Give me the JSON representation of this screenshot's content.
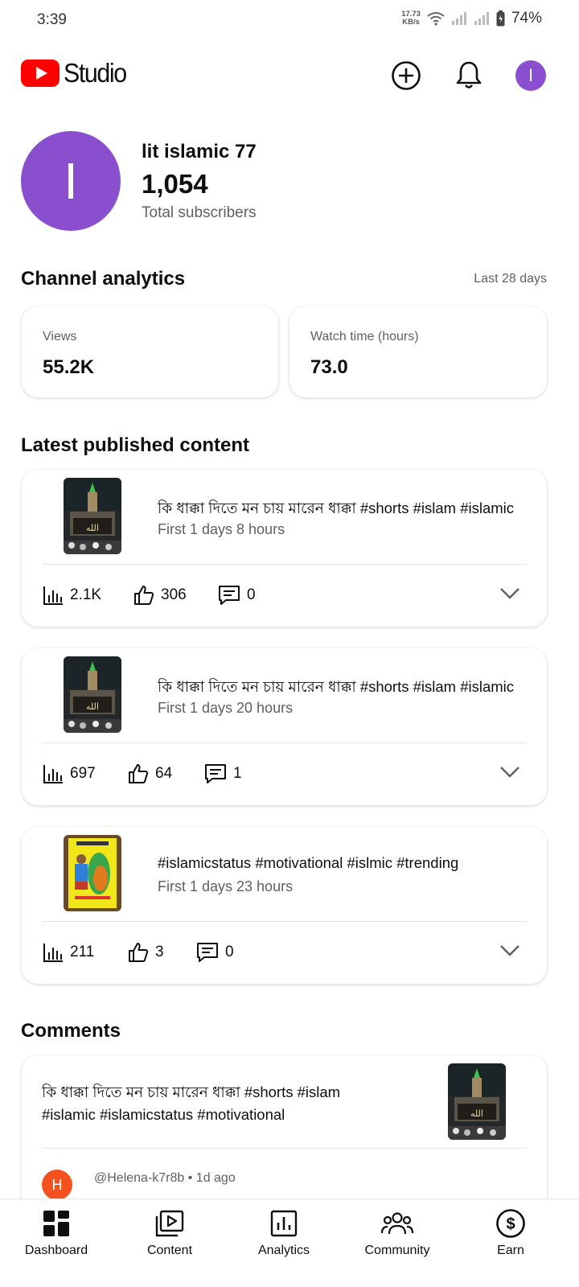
{
  "status_bar": {
    "time": "3:39",
    "net_speed_value": "17.73",
    "net_speed_unit": "KB/s",
    "battery": "74%"
  },
  "app_bar": {
    "logo_text": "Studio",
    "avatar_initial": "I",
    "icons": [
      "create-icon",
      "bell-icon"
    ]
  },
  "channel": {
    "initial": "I",
    "name": "lit islamic 77",
    "subscribers": "1,054",
    "subscribers_label": "Total subscribers"
  },
  "analytics": {
    "title": "Channel analytics",
    "range": "Last 28 days",
    "metrics": [
      {
        "label": "Views",
        "value": "55.2K"
      },
      {
        "label": "Watch time (hours)",
        "value": "73.0"
      }
    ]
  },
  "latest": {
    "title": "Latest published content",
    "items": [
      {
        "title": "কি ধাক্কা দিতে মন চায় মারেন ধাক্কা #shorts #islam #islamic",
        "sub": "First 1 days 8 hours",
        "views": "2.1K",
        "likes": "306",
        "comments": "0",
        "thumb": "kaaba-night"
      },
      {
        "title": "কি ধাক্কা দিতে মন চায় মারেন ধাক্কা #shorts #islam #islamic",
        "sub": "First 1 days 20 hours",
        "views": "697",
        "likes": "64",
        "comments": "1",
        "thumb": "kaaba-night"
      },
      {
        "title": "#islamicstatus #motivational #islmic #trending",
        "sub": "First 1 days 23 hours",
        "views": "211",
        "likes": "3",
        "comments": "0",
        "thumb": "yellow-frame"
      }
    ]
  },
  "comments": {
    "title": "Comments",
    "video_title": "কি ধাক্কা দিতে মন চায় মারেন ধাক্কা #shorts #islam #islamic #islamicstatus #motivational",
    "author_initial": "H",
    "meta": "@Helena-k7r8b • 1d ago"
  },
  "bottom_nav": {
    "items": [
      {
        "label": "Dashboard",
        "icon": "dashboard-icon"
      },
      {
        "label": "Content",
        "icon": "content-icon"
      },
      {
        "label": "Analytics",
        "icon": "analytics-icon"
      },
      {
        "label": "Community",
        "icon": "community-icon"
      },
      {
        "label": "Earn",
        "icon": "earn-icon"
      }
    ]
  },
  "colors": {
    "brand_red": "#ff0000",
    "avatar_purple": "#8a4fce",
    "commenter_orange": "#f4511e",
    "secondary_text": "#606060"
  }
}
